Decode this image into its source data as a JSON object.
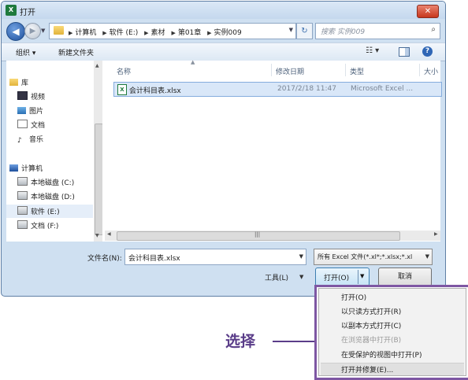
{
  "window": {
    "app_icon": "X",
    "title": "打开",
    "close_label": "✕"
  },
  "address": {
    "crumbs": [
      "计算机",
      "软件 (E:)",
      "素材",
      "第01章",
      "实例009"
    ],
    "search_placeholder": "搜索 实例009"
  },
  "toolbar": {
    "organize_label": "组织 ▾",
    "new_folder_label": "新建文件夹",
    "view_label": "☷ ▾"
  },
  "nav": {
    "library": "库",
    "items": [
      "视频",
      "图片",
      "文档",
      "音乐"
    ],
    "computer": "计算机",
    "drives": [
      "本地磁盘 (C:)",
      "本地磁盘 (D:)",
      "软件 (E:)",
      "文档 (F:)"
    ]
  },
  "columns": {
    "name": "名称",
    "modified": "修改日期",
    "type": "类型",
    "size": "大小"
  },
  "files": [
    {
      "name": "会计科目表.xlsx",
      "date": "2017/2/18 11:47",
      "type": "Microsoft Excel ..."
    }
  ],
  "footer": {
    "filename_label": "文件名(N):",
    "filename_value": "会计科目表.xlsx",
    "filter": "所有 Excel 文件(*.xl*;*.xlsx;*.xl",
    "tools_label": "工具(L)",
    "open_label": "打开(O)",
    "cancel_label": "取消"
  },
  "open_menu": {
    "items": [
      {
        "label": "打开(O)",
        "enabled": true
      },
      {
        "label": "以只读方式打开(R)",
        "enabled": true
      },
      {
        "label": "以副本方式打开(C)",
        "enabled": true
      },
      {
        "label": "在浏览器中打开(B)",
        "enabled": false
      },
      {
        "label": "在受保护的视图中打开(P)",
        "enabled": true
      },
      {
        "label": "打开并修复(E)...",
        "enabled": true
      }
    ]
  },
  "annotation": {
    "label": "选择"
  },
  "colors": {
    "annotation": "#5a3d89",
    "menu_border": "#7e57a3",
    "selection": "#d9e7f8"
  }
}
